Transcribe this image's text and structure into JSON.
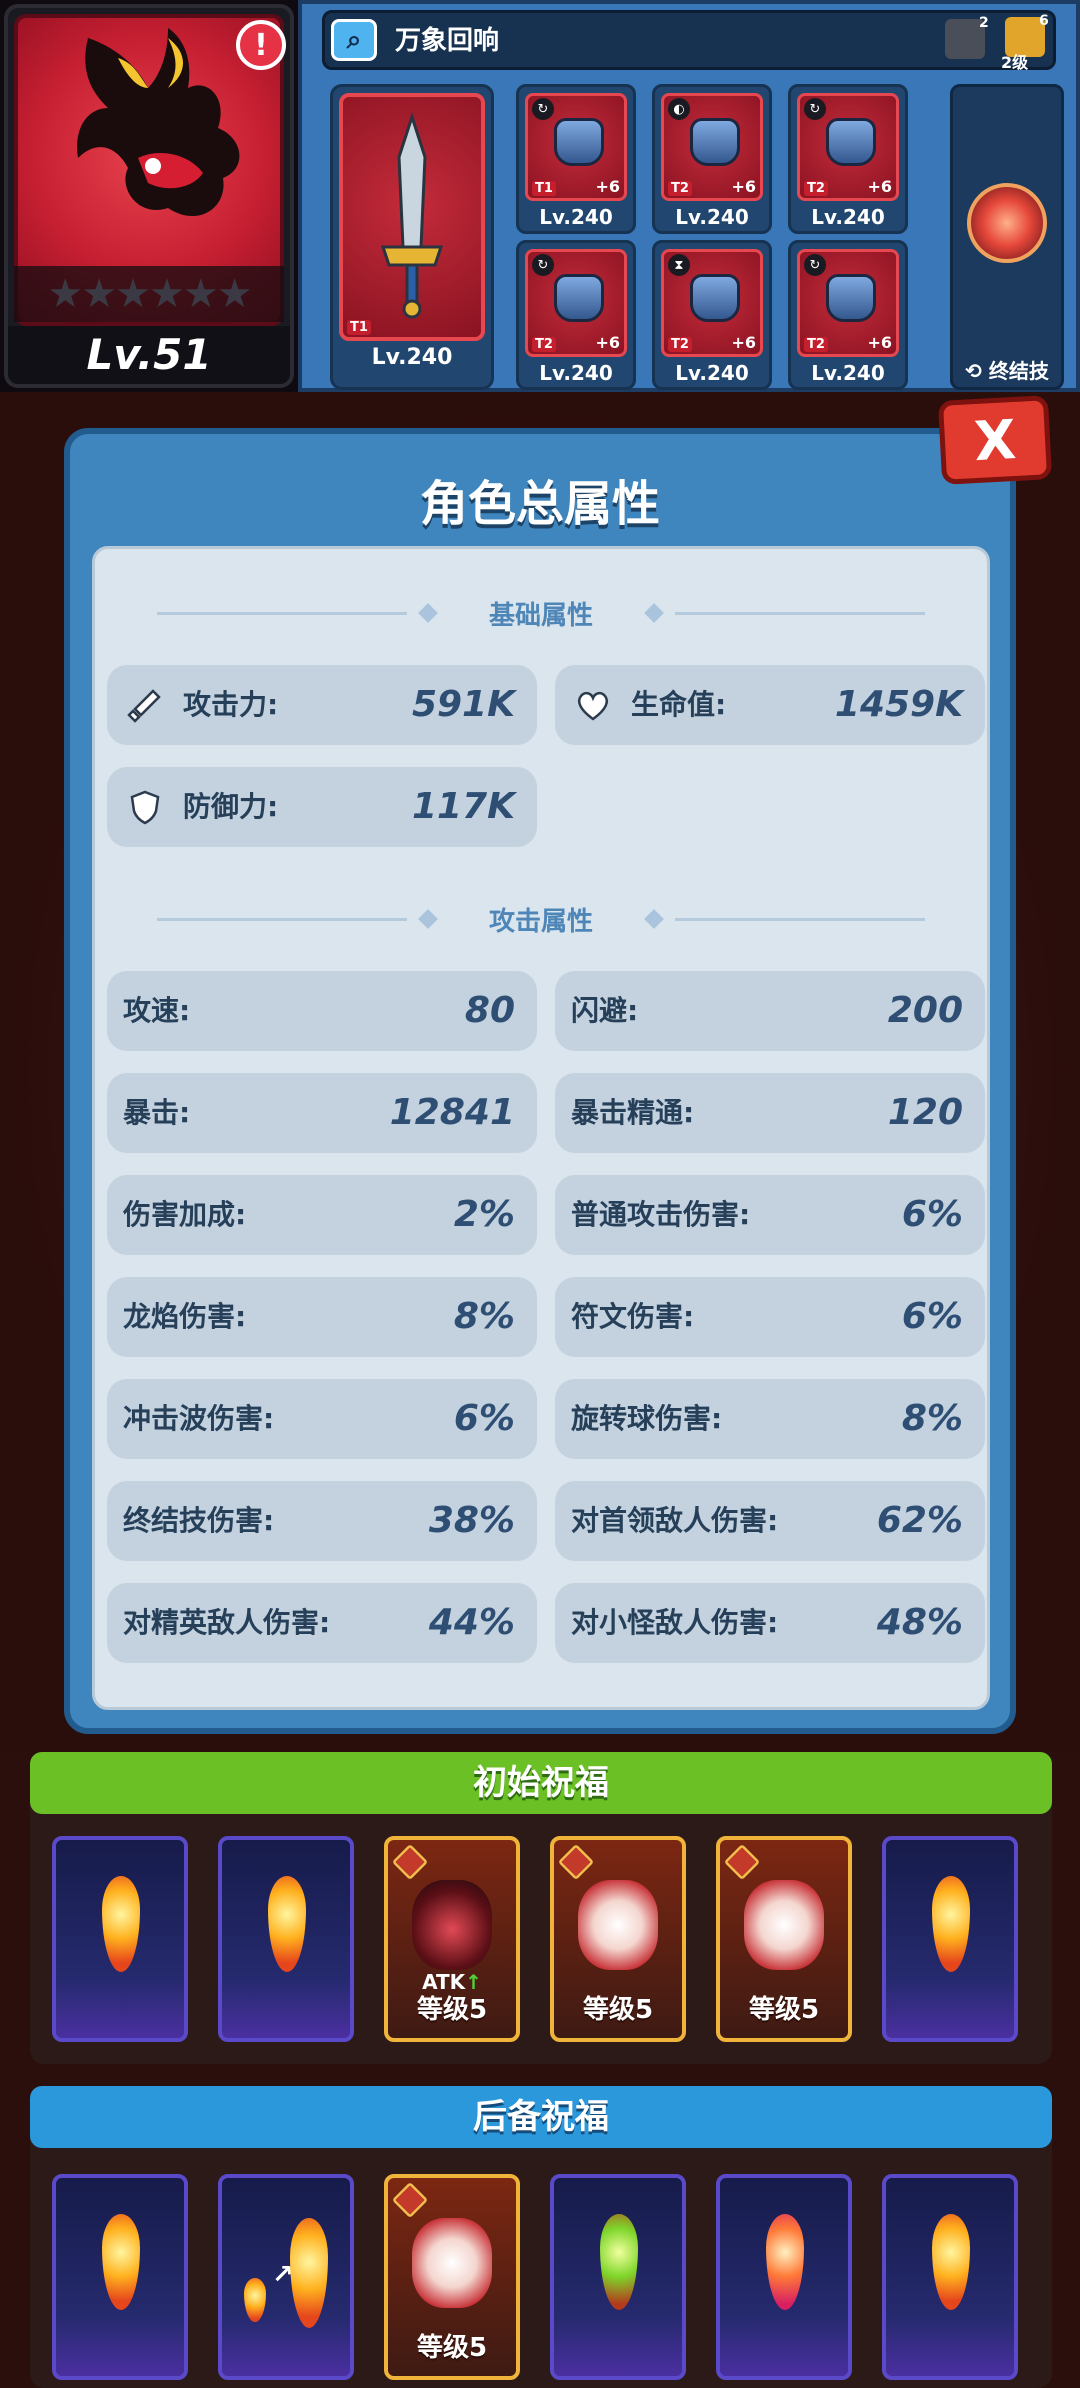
{
  "hero": {
    "level": "Lv.51",
    "alert": "!",
    "stars": "★★★★★★"
  },
  "equipment": {
    "search_label": "万象回响",
    "set_icon_1_count": "2",
    "set_icon_2_count": "6",
    "set_icon_2_level": "2级",
    "weapon": {
      "tier": "T1",
      "level": "Lv.240"
    },
    "gear": [
      {
        "tier": "T1",
        "plus": "+6",
        "level": "Lv.240",
        "badge": "↻"
      },
      {
        "tier": "T2",
        "plus": "+6",
        "level": "Lv.240",
        "badge": "◐"
      },
      {
        "tier": "T2",
        "plus": "+6",
        "level": "Lv.240",
        "badge": "↻"
      },
      {
        "tier": "T2",
        "plus": "+6",
        "level": "Lv.240",
        "badge": "↻"
      },
      {
        "tier": "T2",
        "plus": "+6",
        "level": "Lv.240",
        "badge": "⧗"
      },
      {
        "tier": "T2",
        "plus": "+6",
        "level": "Lv.240",
        "badge": "↻"
      }
    ],
    "ultimate_label": "终结技"
  },
  "modal": {
    "title": "角色总属性",
    "close": "X",
    "basic_section": "基础属性",
    "attack_section": "攻击属性",
    "basic_stats": [
      {
        "label": "攻击力:",
        "value": "591K",
        "icon": "sword-icon"
      },
      {
        "label": "生命值:",
        "value": "1459K",
        "icon": "heart-icon"
      },
      {
        "label": "防御力:",
        "value": "117K",
        "icon": "shield-icon"
      }
    ],
    "attack_stats": [
      {
        "label": "攻速:",
        "value": "80"
      },
      {
        "label": "闪避:",
        "value": "200"
      },
      {
        "label": "暴击:",
        "value": "12841"
      },
      {
        "label": "暴击精通:",
        "value": "120"
      },
      {
        "label": "伤害加成:",
        "value": "2%"
      },
      {
        "label": "普通攻击伤害:",
        "value": "6%"
      },
      {
        "label": "龙焰伤害:",
        "value": "8%"
      },
      {
        "label": "符文伤害:",
        "value": "6%"
      },
      {
        "label": "冲击波伤害:",
        "value": "6%"
      },
      {
        "label": "旋转球伤害:",
        "value": "8%"
      },
      {
        "label": "终结技伤害:",
        "value": "38%"
      },
      {
        "label": "对首领敌人伤害:",
        "value": "62%"
      },
      {
        "label": "对精英敌人伤害:",
        "value": "44%"
      },
      {
        "label": "对小怪敌人伤害:",
        "value": "48%"
      }
    ]
  },
  "blessings": {
    "initial_title": "初始祝福",
    "reserve_title": "后备祝福",
    "initial_cards": [
      {
        "type": "flame",
        "color": "orange"
      },
      {
        "type": "flame",
        "color": "orange"
      },
      {
        "type": "skill",
        "level": "等级5",
        "atk": "ATK",
        "art": "dragon"
      },
      {
        "type": "skill",
        "level": "等级5",
        "art": "gourd"
      },
      {
        "type": "skill",
        "level": "等级5",
        "art": "bomb"
      },
      {
        "type": "flame",
        "color": "orange"
      }
    ],
    "reserve_cards": [
      {
        "type": "flame",
        "color": "orange"
      },
      {
        "type": "flame-upgrade",
        "color": "orange"
      },
      {
        "type": "skill",
        "level": "等级5",
        "art": "blade"
      },
      {
        "type": "flame",
        "color": "green"
      },
      {
        "type": "flame",
        "color": "pink"
      },
      {
        "type": "flame",
        "color": "orange"
      }
    ]
  }
}
